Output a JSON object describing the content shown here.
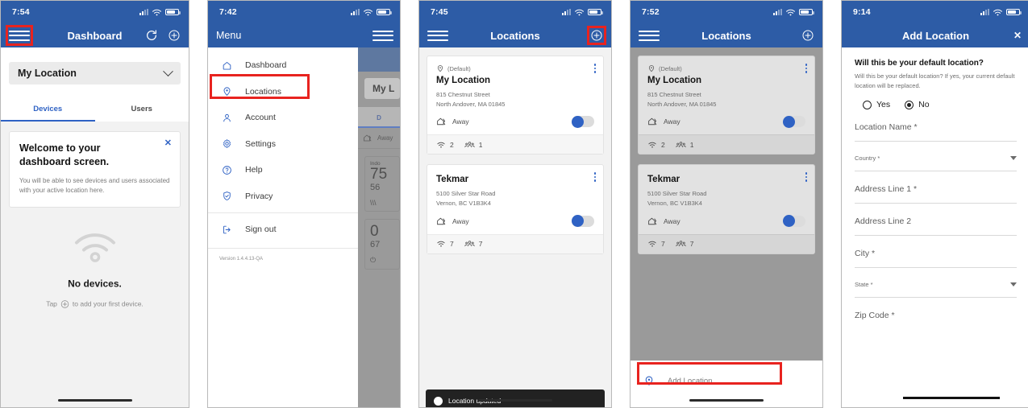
{
  "colors": {
    "brand": "#2d5ca6",
    "accent": "#2f62c4",
    "highlight": "#e8231f",
    "toggle_on": "#2f62c4"
  },
  "panel1": {
    "status_time": "7:54",
    "app_title": "Dashboard",
    "menu_icon": "hamburger-icon",
    "refresh_icon": "refresh-icon",
    "add_icon": "plus-circle-icon",
    "location_selector": "My Location",
    "tabs": [
      {
        "label": "Devices",
        "active": true
      },
      {
        "label": "Users",
        "active": false
      }
    ],
    "welcome": {
      "title": "Welcome to your dashboard screen.",
      "body": "You will be able to see devices and users associated with your active location here.",
      "close": "✕"
    },
    "empty": {
      "icon": "wifi-icon",
      "title": "No devices.",
      "hint_before": "Tap",
      "hint_after": "to add your first device."
    }
  },
  "panel2": {
    "status_time": "7:42",
    "app_title": "Menu",
    "menu_items": [
      {
        "label": "Dashboard",
        "icon": "home-icon"
      },
      {
        "label": "Locations",
        "icon": "location-pin-icon",
        "highlighted": true
      },
      {
        "label": "Account",
        "icon": "person-icon"
      },
      {
        "label": "Settings",
        "icon": "gear-icon"
      },
      {
        "label": "Help",
        "icon": "question-circle-icon"
      },
      {
        "label": "Privacy",
        "icon": "shield-check-icon"
      },
      {
        "label": "Sign out",
        "icon": "sign-out-icon"
      }
    ],
    "version": "Version 1.4.4.13-QA",
    "peek": {
      "location_selector": "My L",
      "tab": "D",
      "away": "Away",
      "card1_title": "Indo",
      "card1_big": "75",
      "card1_mid": "56",
      "card2_big": "0",
      "card2_mid": "67"
    }
  },
  "panel3": {
    "status_time": "7:45",
    "app_title": "Locations",
    "add_icon": "plus-circle-icon",
    "locations": [
      {
        "default_label": "(Default)",
        "name": "My Location",
        "address1": "815 Chestnut Street",
        "address2": "North Andover, MA 01845",
        "presence": "Away",
        "devices": "2",
        "users": "1"
      },
      {
        "default_label": "",
        "name": "Tekmar",
        "address1": "5100 Silver Star Road",
        "address2": "Vernon, BC V1B3K4",
        "presence": "Away",
        "devices": "7",
        "users": "7"
      }
    ],
    "toast": "Location updated"
  },
  "panel4": {
    "status_time": "7:52",
    "app_title": "Locations",
    "locations": [
      {
        "default_label": "(Default)",
        "name": "My Location",
        "address1": "815 Chestnut Street",
        "address2": "North Andover, MA 01845",
        "presence": "Away",
        "devices": "2",
        "users": "1"
      },
      {
        "default_label": "",
        "name": "Tekmar",
        "address1": "5100 Silver Star Road",
        "address2": "Vernon, BC V1B3K4",
        "presence": "Away",
        "devices": "7",
        "users": "7"
      }
    ],
    "sheet_item": "Add Location",
    "sheet_icon": "location-pin-icon"
  },
  "panel5": {
    "status_time": "9:14",
    "app_title": "Add Location",
    "close_label": "✕",
    "question": "Will this be your default location?",
    "description": "Will this be your default location? If yes, your current default location will be replaced.",
    "radios": [
      {
        "label": "Yes",
        "selected": false
      },
      {
        "label": "No",
        "selected": true
      }
    ],
    "fields": [
      {
        "label": "Location Name *",
        "type": "text"
      },
      {
        "label": "Country *",
        "type": "select"
      },
      {
        "label": "Address Line 1 *",
        "type": "text"
      },
      {
        "label": "Address Line 2",
        "type": "text"
      },
      {
        "label": "City *",
        "type": "text"
      },
      {
        "label": "State *",
        "type": "select"
      },
      {
        "label": "Zip Code *",
        "type": "text"
      }
    ]
  }
}
